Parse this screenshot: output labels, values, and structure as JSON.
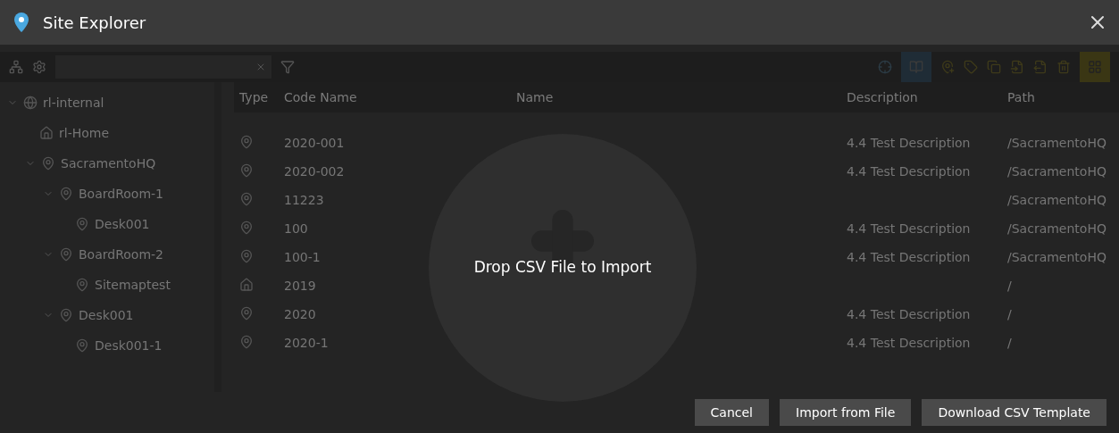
{
  "window": {
    "title": "Site Explorer"
  },
  "tree": [
    {
      "label": "rl-internal",
      "kind": "globe",
      "expanded": true,
      "children": [
        {
          "label": "rl-Home",
          "kind": "home"
        },
        {
          "label": "SacramentoHQ",
          "kind": "pin",
          "expanded": true,
          "children": [
            {
              "label": "BoardRoom-1",
              "kind": "pin",
              "expanded": true,
              "children": [
                {
                  "label": "Desk001",
                  "kind": "pin"
                }
              ]
            },
            {
              "label": "BoardRoom-2",
              "kind": "pin",
              "expanded": true,
              "children": [
                {
                  "label": "Sitemaptest",
                  "kind": "pin"
                }
              ]
            },
            {
              "label": "Desk001",
              "kind": "pin",
              "expanded": true,
              "children": [
                {
                  "label": "Desk001-1",
                  "kind": "pin"
                }
              ]
            }
          ]
        }
      ]
    }
  ],
  "table": {
    "columns": [
      "Type",
      "Code Name",
      "Name",
      "Description",
      "Path"
    ],
    "rows": [
      {
        "kind": "pin",
        "code": "2020-001",
        "description": "4.4 Test Description",
        "path": "/SacramentoHQ"
      },
      {
        "kind": "pin",
        "code": "2020-002",
        "description": "4.4 Test Description",
        "path": "/SacramentoHQ"
      },
      {
        "kind": "pin",
        "code": "11223",
        "description": "",
        "path": "/SacramentoHQ"
      },
      {
        "kind": "pin",
        "code": "100",
        "description": "4.4 Test Description",
        "path": "/SacramentoHQ"
      },
      {
        "kind": "pin",
        "code": "100-1",
        "description": "4.4 Test Description",
        "path": "/SacramentoHQ"
      },
      {
        "kind": "home",
        "code": "2019",
        "description": "",
        "path": "/"
      },
      {
        "kind": "pin",
        "code": "2020",
        "description": "4.4 Test Description",
        "path": "/"
      },
      {
        "kind": "pin",
        "code": "2020-1",
        "description": "4.4 Test Description",
        "path": "/"
      }
    ]
  },
  "drop_zone": {
    "message": "Drop CSV File to Import"
  },
  "buttons": [
    "Cancel",
    "Import from File",
    "Download CSV Template"
  ]
}
